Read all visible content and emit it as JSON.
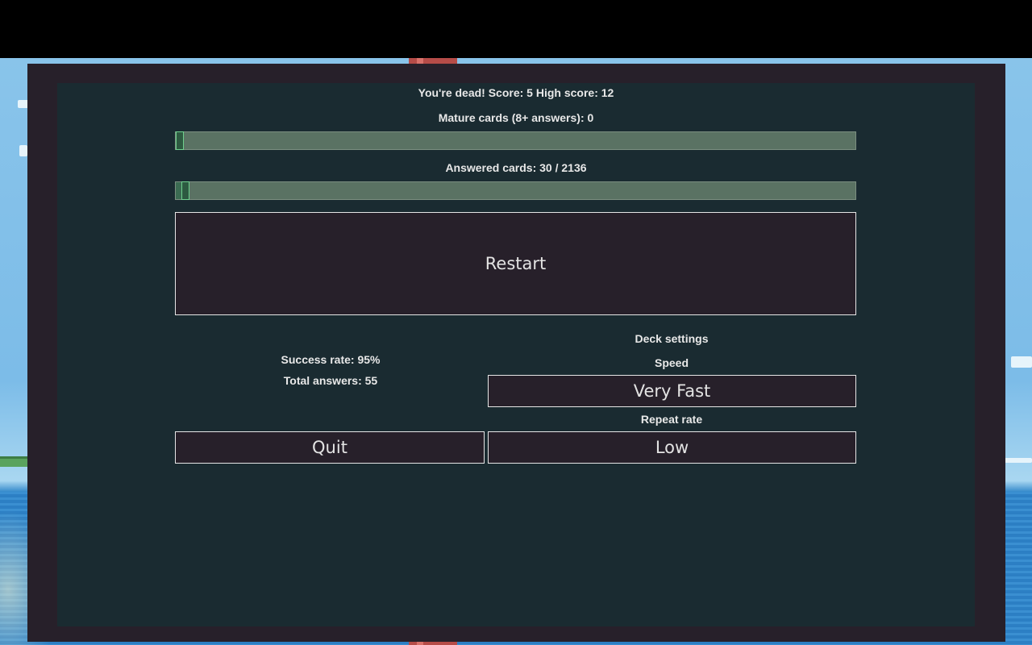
{
  "game_over": {
    "status_line": "You're dead! Score: 5 High score: 12",
    "score": 5,
    "high_score": 12
  },
  "mature_cards": {
    "label": "Mature cards (8+ answers):  0",
    "value": 0,
    "progress_fraction": 0.0
  },
  "answered_cards": {
    "label": "Answered cards:  30 / 2136",
    "answered": 30,
    "total": 2136,
    "progress_fraction": 0.014
  },
  "buttons": {
    "restart": "Restart",
    "quit": "Quit"
  },
  "stats": {
    "success_rate": "Success rate: 95%",
    "total_answers": "Total answers: 55"
  },
  "deck_settings": {
    "heading": "Deck settings",
    "speed_label": "Speed",
    "speed_value": "Very Fast",
    "repeat_rate_label": "Repeat rate",
    "repeat_rate_value": "Low"
  },
  "colors": {
    "panel_bg": "#1a2b31",
    "frame_bg": "#27202a",
    "progress_track": "#5a7263",
    "progress_handle": "#6fd08e",
    "text": "#e8e8e8"
  }
}
